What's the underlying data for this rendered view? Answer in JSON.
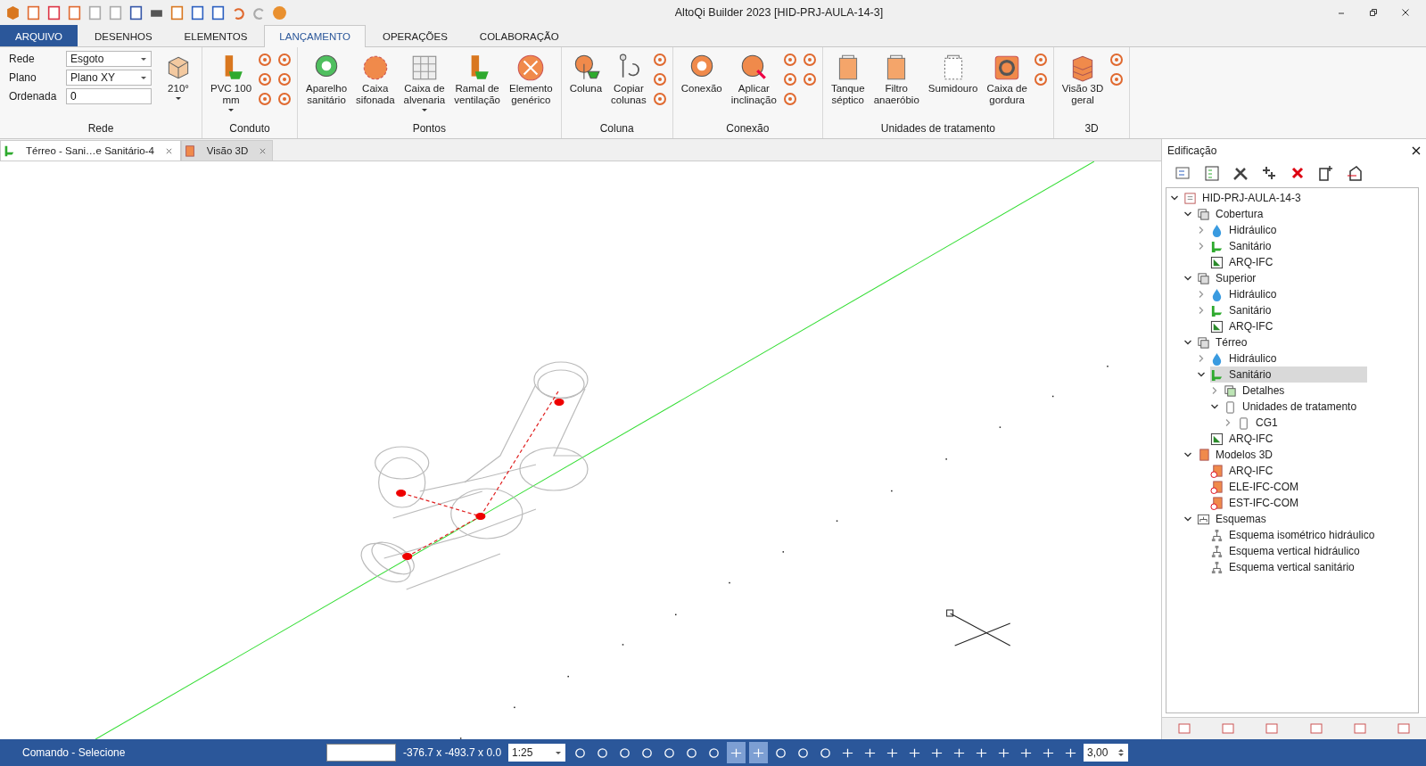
{
  "window": {
    "title": "AltoQi Builder 2023 [HID-PRJ-AULA-14-3]"
  },
  "ribbon": {
    "tabs": [
      {
        "label": "ARQUIVO",
        "kind": "file",
        "selected": false
      },
      {
        "label": "DESENHOS",
        "kind": "tab",
        "selected": false
      },
      {
        "label": "ELEMENTOS",
        "kind": "tab",
        "selected": false
      },
      {
        "label": "LANÇAMENTO",
        "kind": "tab",
        "selected": true
      },
      {
        "label": "OPERAÇÕES",
        "kind": "tab",
        "selected": false
      },
      {
        "label": "COLABORAÇÃO",
        "kind": "tab",
        "selected": false
      }
    ],
    "groups": [
      {
        "title": "Rede",
        "fields": [
          {
            "label": "Rede",
            "value": "Esgoto",
            "kind": "dropdown"
          },
          {
            "label": "Plano",
            "value": "Plano XY",
            "kind": "dropdown"
          },
          {
            "label": "Ordenada",
            "value": "0",
            "kind": "input"
          }
        ],
        "buttons": [
          {
            "label": "210°",
            "dropdown": true
          }
        ]
      },
      {
        "title": "Conduto",
        "buttons": [
          {
            "label": "PVC 100\nmm",
            "dropdown": true
          }
        ]
      },
      {
        "title": "Pontos",
        "buttons": [
          {
            "label": "Aparelho\nsanitário",
            "dropdown": false
          },
          {
            "label": "Caixa\nsifonada",
            "dropdown": false
          },
          {
            "label": "Caixa de\nalvenaria",
            "dropdown": true
          },
          {
            "label": "Ramal de\nventilação",
            "dropdown": false
          },
          {
            "label": "Elemento\ngenérico",
            "dropdown": false
          }
        ]
      },
      {
        "title": "Coluna",
        "buttons": [
          {
            "label": "Coluna",
            "dropdown": false
          },
          {
            "label": "Copiar\ncolunas",
            "dropdown": false
          }
        ]
      },
      {
        "title": "Conexão",
        "buttons": [
          {
            "label": "Conexão",
            "dropdown": false
          },
          {
            "label": "Aplicar\ninclinação",
            "dropdown": false
          }
        ]
      },
      {
        "title": "Unidades de tratamento",
        "buttons": [
          {
            "label": "Tanque\nséptico",
            "dropdown": false
          },
          {
            "label": "Filtro\nanaeróbio",
            "dropdown": false
          },
          {
            "label": "Sumidouro",
            "dropdown": false
          },
          {
            "label": "Caixa de\ngordura",
            "dropdown": false
          }
        ]
      },
      {
        "title": "3D",
        "buttons": [
          {
            "label": "Visão 3D\ngeral",
            "dropdown": false
          }
        ]
      }
    ]
  },
  "documents": [
    {
      "label": "Térreo - Sani…e Sanitário-4",
      "kind": "plan",
      "selected": true
    },
    {
      "label": "Visão 3D",
      "kind": "view3d",
      "selected": false
    }
  ],
  "panel": {
    "title": "Edificação",
    "tree": [
      {
        "label": "HID-PRJ-AULA-14-3",
        "kind": "project",
        "expanded": true,
        "selected": false,
        "children": [
          {
            "label": "Cobertura",
            "kind": "floor",
            "expanded": true,
            "selected": false,
            "children": [
              {
                "label": "Hidráulico",
                "kind": "water",
                "expanded": false,
                "selected": false
              },
              {
                "label": "Sanitário",
                "kind": "sewer",
                "expanded": false,
                "selected": false
              },
              {
                "label": "ARQ-IFC",
                "kind": "drawing",
                "selected": false
              }
            ]
          },
          {
            "label": "Superior",
            "kind": "floor",
            "expanded": true,
            "selected": false,
            "children": [
              {
                "label": "Hidráulico",
                "kind": "water",
                "expanded": false,
                "selected": false
              },
              {
                "label": "Sanitário",
                "kind": "sewer",
                "expanded": false,
                "selected": false
              },
              {
                "label": "ARQ-IFC",
                "kind": "drawing",
                "selected": false
              }
            ]
          },
          {
            "label": "Térreo",
            "kind": "floor",
            "expanded": true,
            "selected": false,
            "children": [
              {
                "label": "Hidráulico",
                "kind": "water",
                "expanded": false,
                "selected": false
              },
              {
                "label": "Sanitário",
                "kind": "sewer",
                "expanded": true,
                "selected": true,
                "children": [
                  {
                    "label": "Detalhes",
                    "kind": "details",
                    "expanded": false,
                    "selected": false
                  },
                  {
                    "label": "Unidades de tratamento",
                    "kind": "unit",
                    "expanded": true,
                    "selected": false,
                    "children": [
                      {
                        "label": "CG1",
                        "kind": "unit",
                        "expanded": false,
                        "selected": false
                      }
                    ]
                  }
                ]
              },
              {
                "label": "ARQ-IFC",
                "kind": "drawing",
                "selected": false
              }
            ]
          },
          {
            "label": "Modelos 3D",
            "kind": "model",
            "expanded": true,
            "selected": false,
            "children": [
              {
                "label": "ARQ-IFC",
                "kind": "model-off",
                "selected": false
              },
              {
                "label": "ELE-IFC-COM",
                "kind": "model-off",
                "selected": false
              },
              {
                "label": "EST-IFC-COM",
                "kind": "model-off",
                "selected": false
              }
            ]
          },
          {
            "label": "Esquemas",
            "kind": "schemes",
            "expanded": true,
            "selected": false,
            "children": [
              {
                "label": "Esquema isométrico hidráulico",
                "kind": "scheme",
                "selected": false
              },
              {
                "label": "Esquema vertical hidráulico",
                "kind": "scheme",
                "selected": false
              },
              {
                "label": "Esquema vertical sanitário",
                "kind": "scheme",
                "selected": false
              }
            ]
          }
        ]
      }
    ]
  },
  "status_bar": {
    "command": "Comando - Selecione",
    "coordinates": "-376.7 x -493.7 x 0.0",
    "scale": "1:25",
    "tools": [
      {
        "selected": false
      },
      {
        "selected": false
      },
      {
        "selected": false
      },
      {
        "selected": false
      },
      {
        "selected": false
      },
      {
        "selected": false
      },
      {
        "selected": false
      },
      {
        "selected": true
      },
      {
        "selected": true
      },
      {
        "selected": false
      },
      {
        "selected": false
      },
      {
        "selected": false
      },
      {
        "selected": false
      },
      {
        "selected": false
      },
      {
        "selected": false
      },
      {
        "selected": false
      },
      {
        "selected": false
      },
      {
        "selected": false
      },
      {
        "selected": false
      },
      {
        "selected": false
      },
      {
        "selected": false
      },
      {
        "selected": false
      },
      {
        "selected": false
      }
    ],
    "spin_value": "3,00"
  }
}
